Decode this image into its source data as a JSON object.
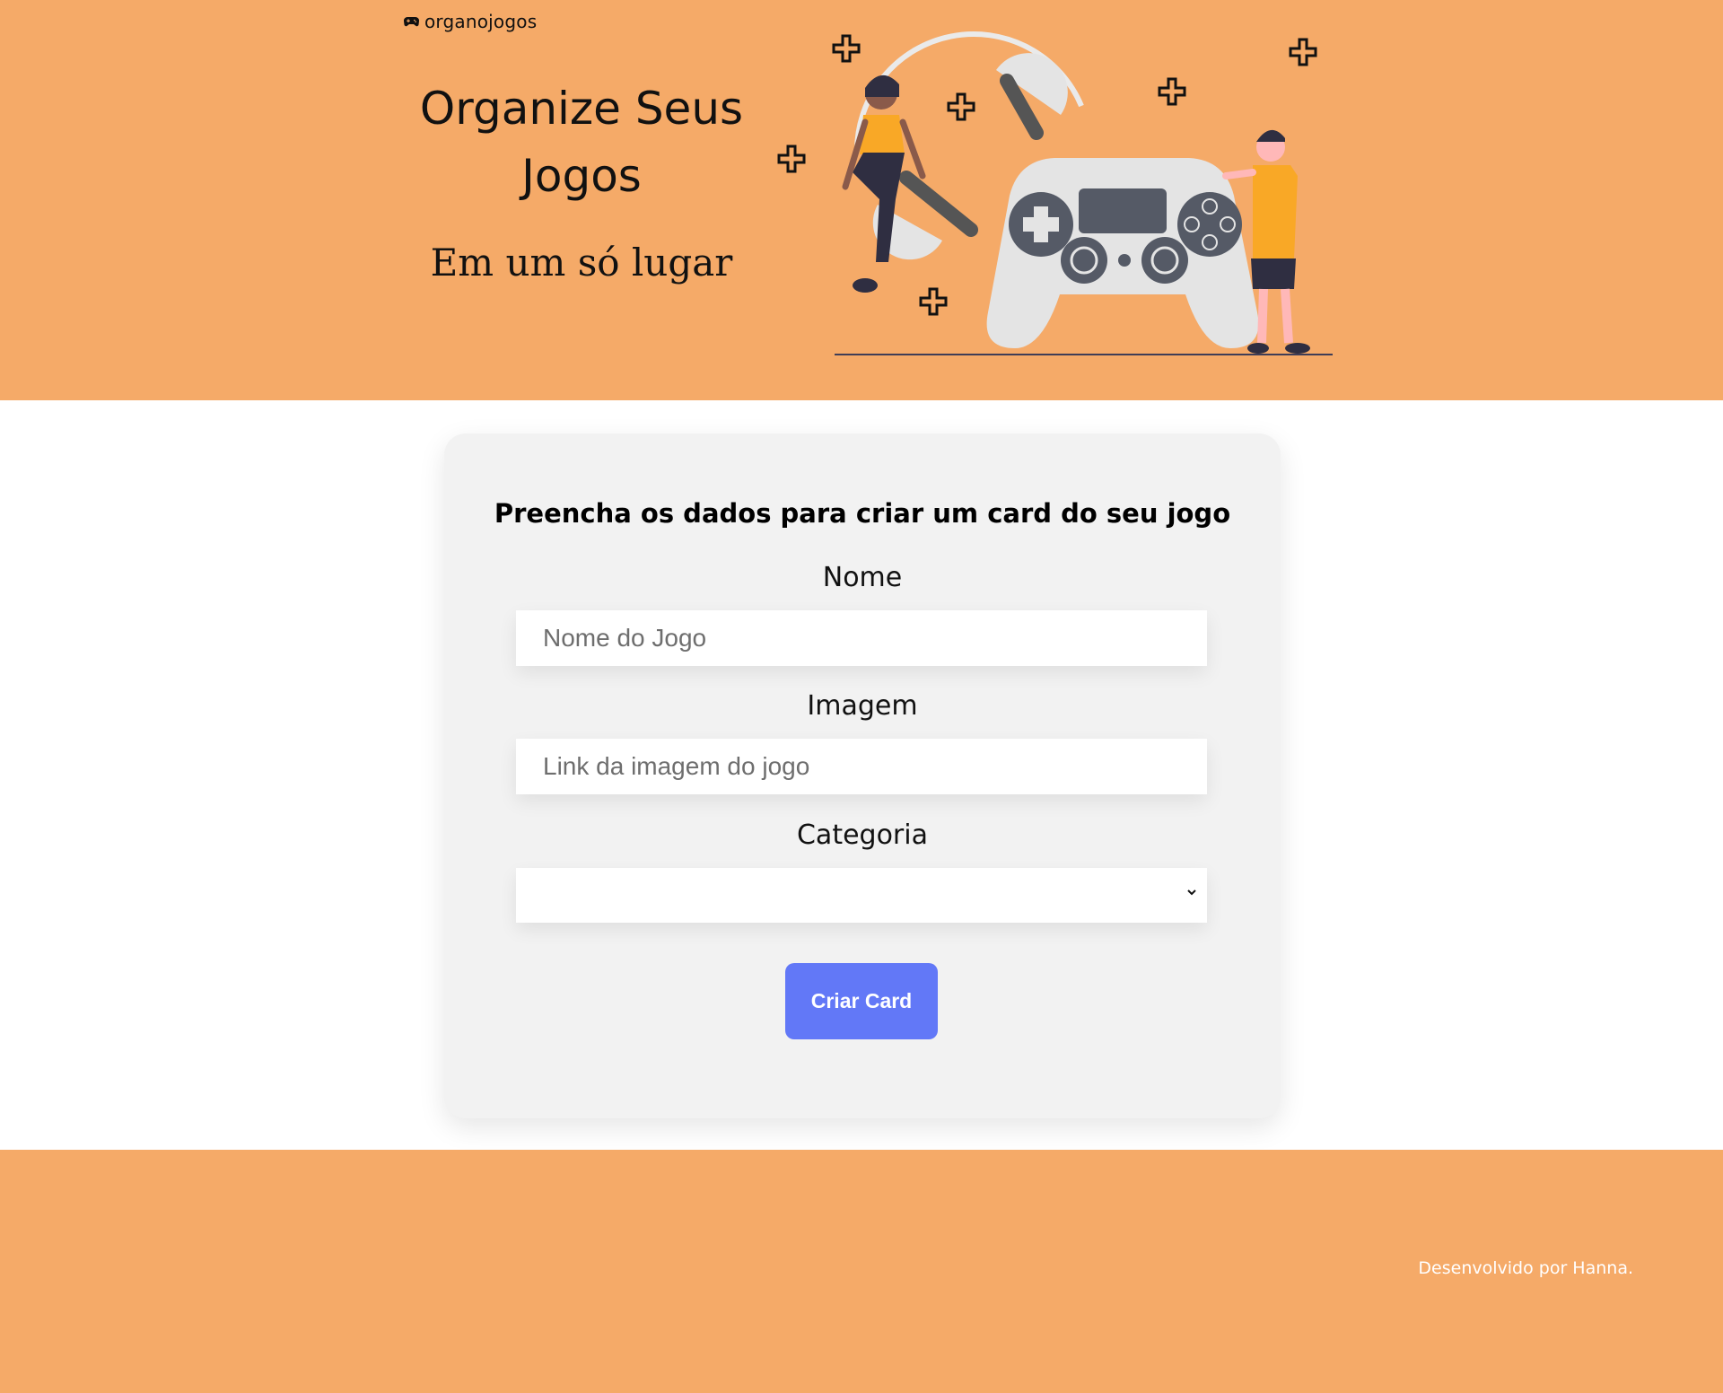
{
  "header": {
    "logo_text": "organojogos",
    "logo_icon": "gamepad-icon",
    "title": "Organize Seus Jogos",
    "subtitle": "Em um só lugar",
    "illustration": "people-with-gamepad-illustration"
  },
  "form": {
    "title": "Preencha os dados para criar um card do seu jogo",
    "fields": [
      {
        "label": "Nome",
        "placeholder": "Nome do Jogo",
        "value": ""
      },
      {
        "label": "Imagem",
        "placeholder": "Link da imagem do jogo",
        "value": ""
      },
      {
        "label": "Categoria",
        "selected": ""
      }
    ],
    "submit_label": "Criar Card"
  },
  "footer": {
    "text": "Desenvolvido por Hanna."
  },
  "colors": {
    "brand": "#F5AA68",
    "button": "#6278F7",
    "card_bg": "#F2F2F2"
  }
}
